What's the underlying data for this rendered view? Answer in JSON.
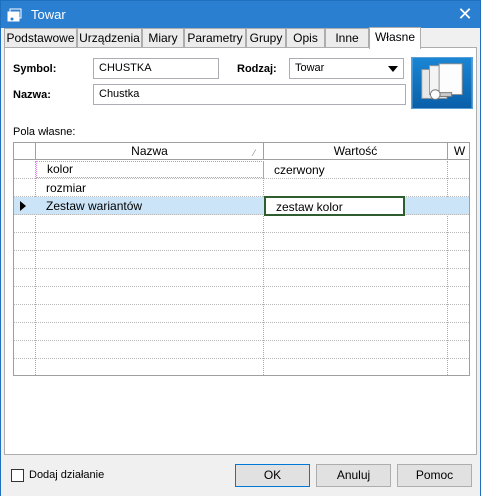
{
  "window": {
    "title": "Towar",
    "close_glyph": "✕"
  },
  "tabs": [
    {
      "label": "Podstawowe",
      "active": false
    },
    {
      "label": "Urządzenia",
      "active": false
    },
    {
      "label": "Miary",
      "active": false
    },
    {
      "label": "Parametry",
      "active": false
    },
    {
      "label": "Grupy",
      "active": false
    },
    {
      "label": "Opis",
      "active": false
    },
    {
      "label": "Inne",
      "active": false
    },
    {
      "label": "Własne",
      "active": true
    }
  ],
  "form": {
    "symbol_label": "Symbol:",
    "symbol_value": "CHUSTKA",
    "rodzaj_label": "Rodzaj:",
    "rodzaj_value": "Towar",
    "nazwa_label": "Nazwa:",
    "nazwa_value": "Chustka"
  },
  "custom_fields": {
    "section_label": "Pola własne:",
    "columns": [
      "Nazwa",
      "Wartość",
      "W"
    ],
    "rows": [
      {
        "name": "kolor",
        "value": "czerwony",
        "selected": false
      },
      {
        "name": "rozmiar",
        "value": "",
        "selected": false
      },
      {
        "name": "Zestaw wariantów",
        "value": "zestaw kolor",
        "selected": true
      }
    ]
  },
  "footer": {
    "checkbox_label": "Dodaj działanie",
    "checkbox_checked": false,
    "ok_label": "OK",
    "cancel_label": "Anuluj",
    "help_label": "Pomoc"
  },
  "colors": {
    "titlebar": "#2b7fd0",
    "selected_row": "#cce4f7",
    "default_button_border": "#0078d7"
  }
}
